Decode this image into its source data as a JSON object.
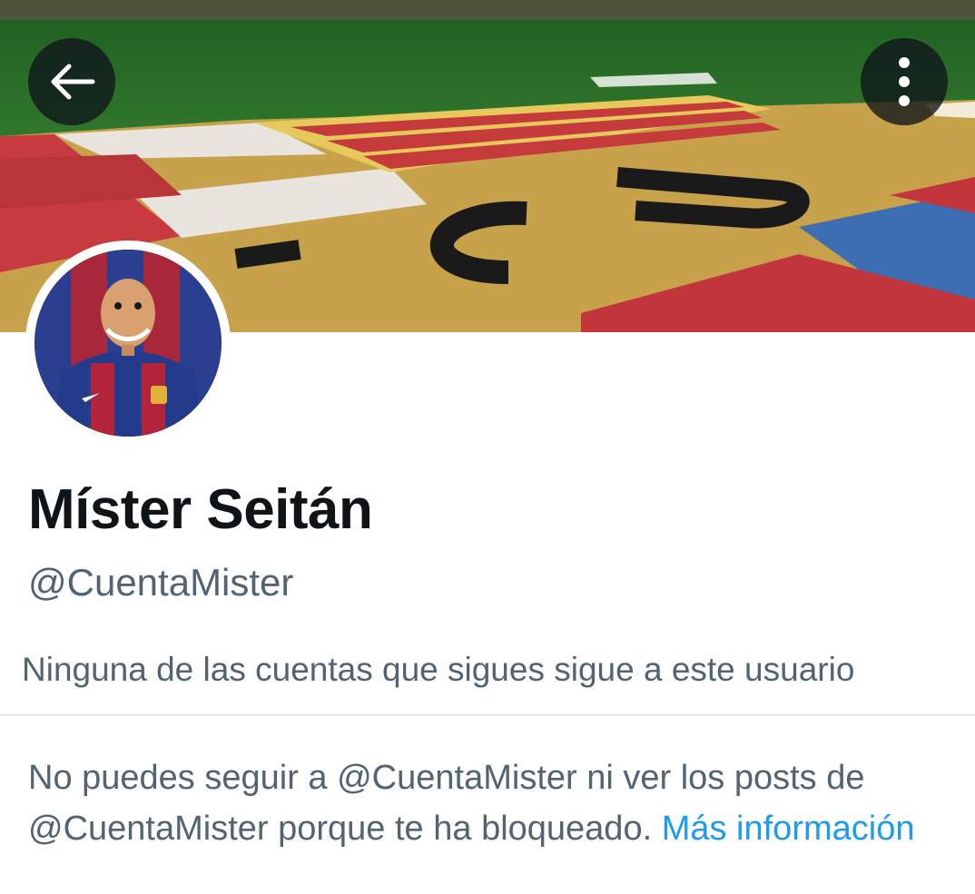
{
  "header": {
    "back_icon": "arrow-left-icon",
    "more_icon": "more-vertical-icon"
  },
  "profile": {
    "display_name": "Míster Seitán",
    "handle": "@CuentaMister",
    "followers_you_know": "Ninguna de las cuentas que sigues sigue a este usuario"
  },
  "blocked_notice": {
    "text": "No puedes seguir a @CuentaMister ni ver los posts de @CuentaMister porque te ha bloqueado.",
    "link_label": "Más información"
  },
  "colors": {
    "text_primary": "#0f1419",
    "text_secondary": "#536471",
    "link": "#1d9bf0"
  }
}
